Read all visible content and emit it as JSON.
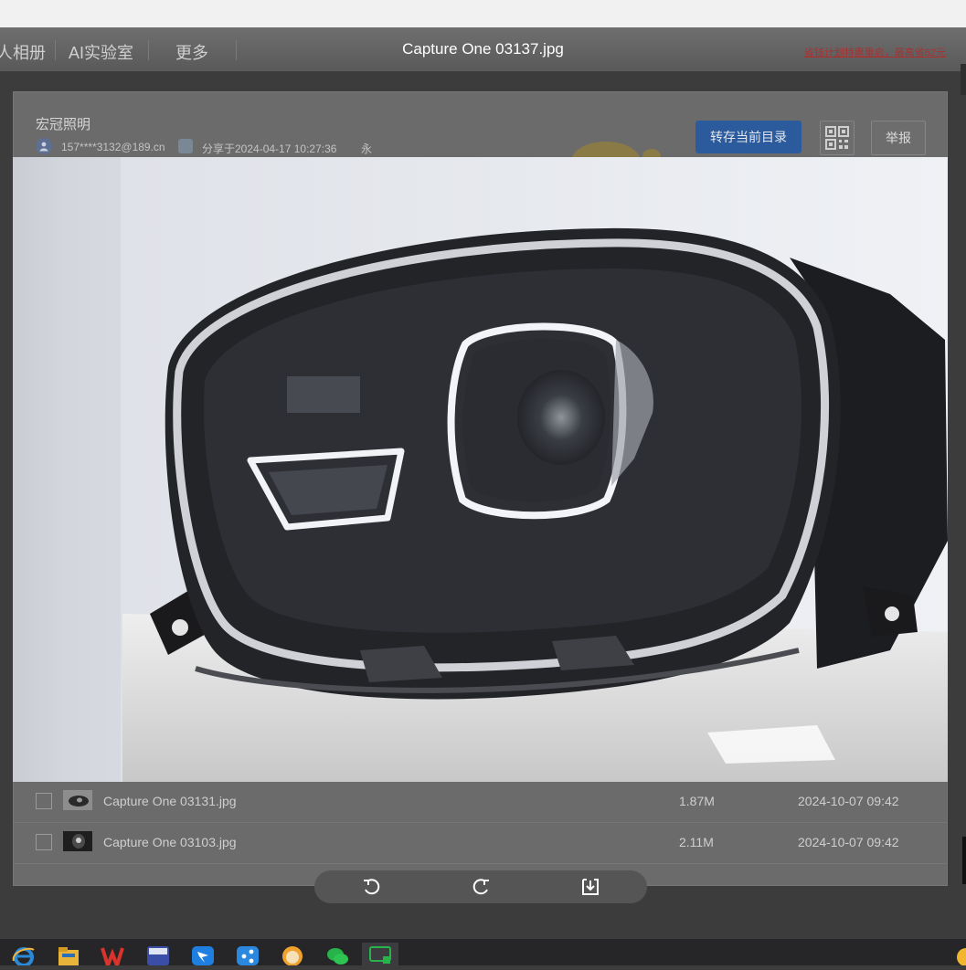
{
  "topnav": {
    "items": [
      "人相册",
      "AI实验室",
      "更多"
    ],
    "viewer_title": "Capture One 03137.jpg",
    "promo": "省钱计划特惠重启，最高省62元"
  },
  "share": {
    "owner": "宏冠照明",
    "email": "157****3132@189.cn",
    "shared_at": "分享于2024-04-17 10:27:36",
    "validity": "永久有效",
    "save_label": "转存当前目录",
    "report_label": "举报"
  },
  "files": [
    {
      "name": "Capture One 03131.jpg",
      "size": "1.87M",
      "date": "2024-10-07 09:42"
    },
    {
      "name": "Capture One 03103.jpg",
      "size": "2.11M",
      "date": "2024-10-07 09:42"
    }
  ],
  "colors": {
    "accent": "#2b5b9c",
    "promo": "#a83232",
    "toolbar": "#555555"
  },
  "icons": {
    "rotate_left": "rotate-left-icon",
    "rotate_right": "rotate-right-icon",
    "download": "download-icon",
    "qrcode": "qrcode-icon"
  }
}
